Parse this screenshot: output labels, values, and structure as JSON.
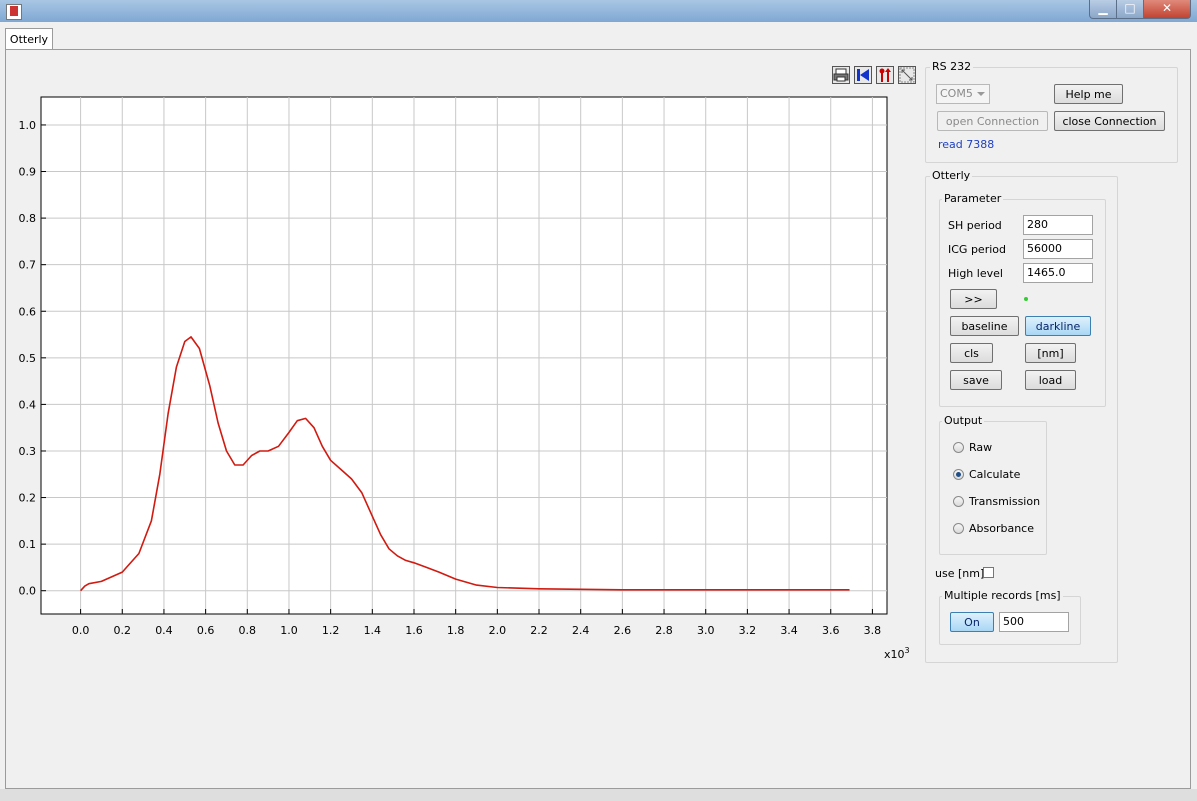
{
  "window": {
    "title": "Otterly",
    "minimize_glyph": "▁",
    "maximize_glyph": "□",
    "close_glyph": "✕"
  },
  "tab": {
    "label": "Otterly"
  },
  "toolbar": {
    "icons": [
      "print-icon",
      "go-to-start-icon",
      "pointer-marker-icon",
      "zoom-fit-icon"
    ]
  },
  "rs232": {
    "title": "RS 232",
    "port": {
      "value": "COM5"
    },
    "help_label": "Help me",
    "open_label": "open Connection",
    "close_label": "close Connection",
    "status": "read 7388",
    "status_color": "#1f3fbf"
  },
  "otterly": {
    "title": "Otterly",
    "parameter": {
      "title": "Parameter",
      "sh_label": "SH period",
      "sh_value": "280",
      "icg_label": "ICG period",
      "icg_value": "56000",
      "high_label": "High level",
      "high_value": "1465.0",
      "forward_label": ">>",
      "led_color": "#33cc33",
      "baseline_label": "baseline",
      "darkline_label": "darkline",
      "cls_label": "cls",
      "nm_label": "[nm]",
      "save_label": "save",
      "load_label": "load"
    },
    "output": {
      "title": "Output",
      "options": [
        "Raw",
        "Calculate",
        "Transmission",
        "Absorbance"
      ],
      "selected": "Calculate"
    },
    "use_nm": {
      "label": "use [nm]",
      "checked": false
    },
    "multiple": {
      "title": "Multiple records [ms]",
      "on_label": "On",
      "ms_value": "500"
    }
  },
  "chart_data": {
    "type": "line",
    "title": "",
    "xlabel": "x10",
    "xlabel_exp": "3",
    "ylabel": "",
    "xlim": [
      -0.19,
      3.87
    ],
    "ylim": [
      -0.05,
      1.06
    ],
    "x_ticks": [
      "0.0",
      "0.2",
      "0.4",
      "0.6",
      "0.8",
      "1.0",
      "1.2",
      "1.4",
      "1.6",
      "1.8",
      "2.0",
      "2.2",
      "2.4",
      "2.6",
      "2.8",
      "3.0",
      "3.2",
      "3.4",
      "3.6",
      "3.8"
    ],
    "y_ticks": [
      "0.0",
      "0.1",
      "0.2",
      "0.3",
      "0.4",
      "0.5",
      "0.6",
      "0.7",
      "0.8",
      "0.9",
      "1.0"
    ],
    "grid": true,
    "series": [
      {
        "color": "#d11a10",
        "x": [
          0.0,
          0.02,
          0.04,
          0.1,
          0.2,
          0.28,
          0.34,
          0.38,
          0.42,
          0.46,
          0.5,
          0.53,
          0.57,
          0.62,
          0.66,
          0.7,
          0.74,
          0.78,
          0.82,
          0.86,
          0.9,
          0.95,
          1.0,
          1.04,
          1.08,
          1.12,
          1.16,
          1.2,
          1.25,
          1.3,
          1.35,
          1.4,
          1.44,
          1.48,
          1.52,
          1.56,
          1.6,
          1.66,
          1.72,
          1.8,
          1.9,
          2.0,
          2.2,
          2.4,
          2.6,
          2.8,
          3.0,
          3.2,
          3.4,
          3.6,
          3.69
        ],
        "y": [
          0.0,
          0.01,
          0.015,
          0.02,
          0.04,
          0.08,
          0.15,
          0.25,
          0.38,
          0.48,
          0.535,
          0.545,
          0.52,
          0.44,
          0.36,
          0.3,
          0.27,
          0.27,
          0.29,
          0.3,
          0.3,
          0.31,
          0.34,
          0.365,
          0.37,
          0.35,
          0.31,
          0.28,
          0.26,
          0.24,
          0.21,
          0.16,
          0.12,
          0.09,
          0.075,
          0.065,
          0.06,
          0.05,
          0.04,
          0.025,
          0.012,
          0.007,
          0.004,
          0.003,
          0.002,
          0.002,
          0.002,
          0.002,
          0.002,
          0.002,
          0.002
        ]
      }
    ]
  }
}
